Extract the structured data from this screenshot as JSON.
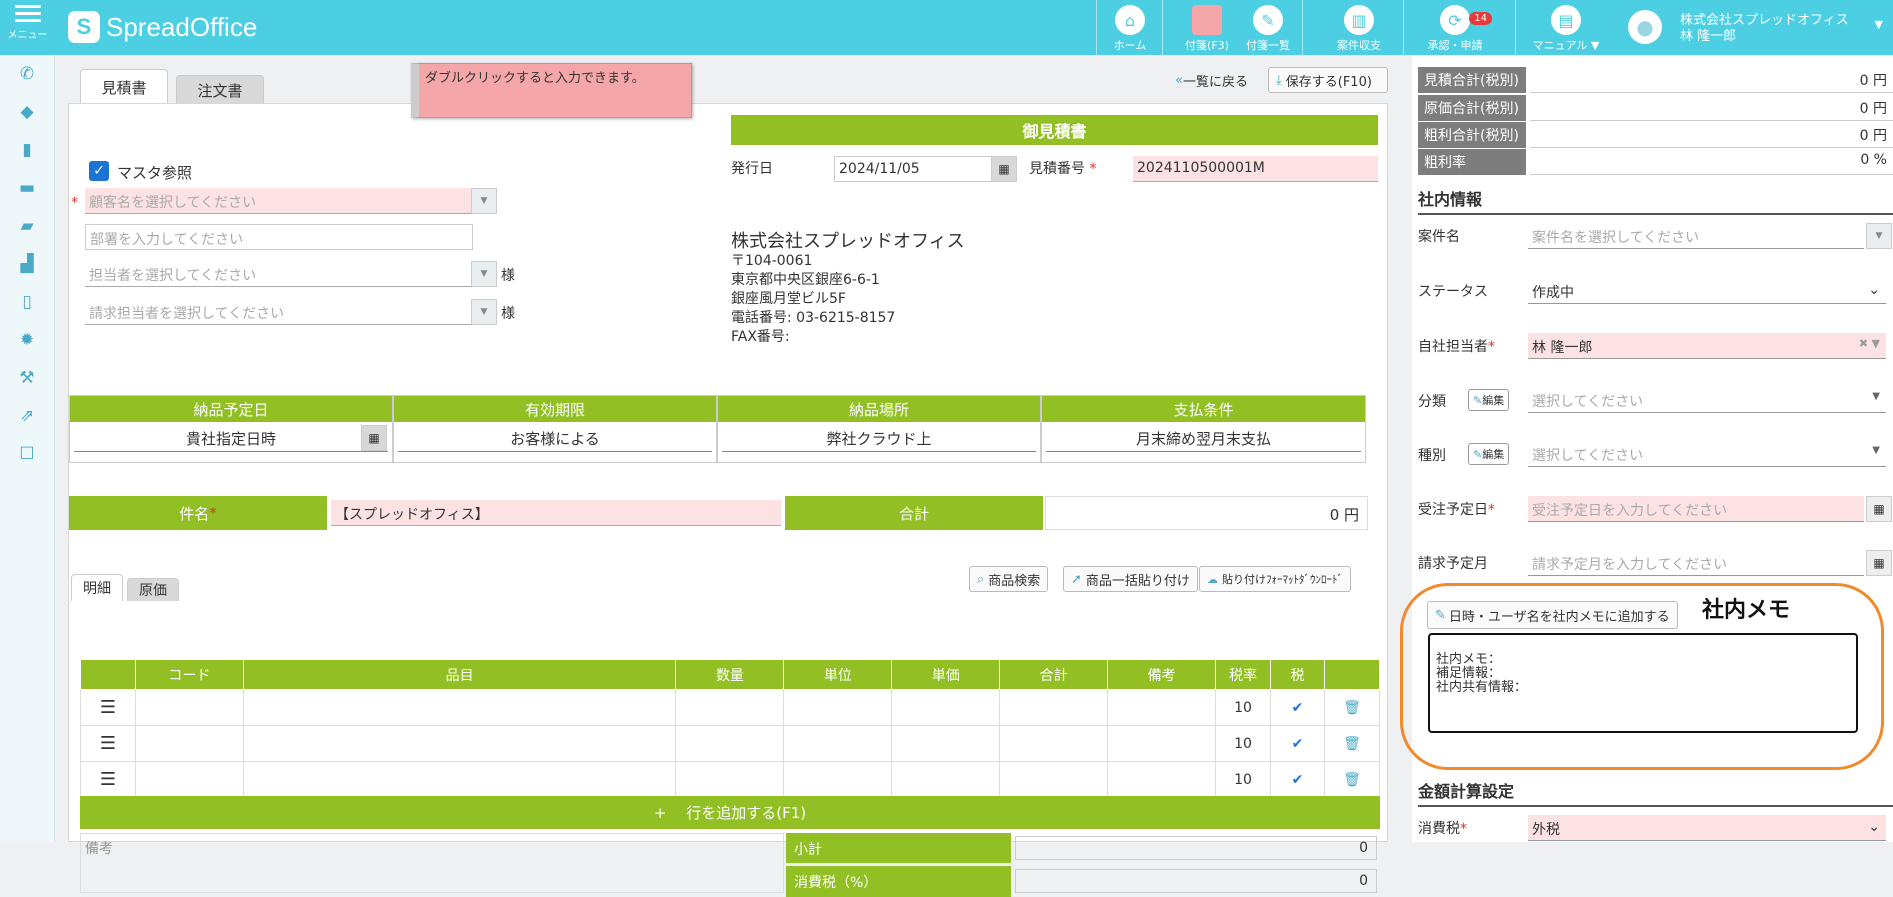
{
  "app": {
    "menu_label": "メニュー",
    "brand": "SpreadOffice"
  },
  "nav": {
    "home": "ホーム",
    "sticky_f3": "付箋(F3)",
    "sticky_list": "付箋一覧",
    "project": "案件収支",
    "approval": "承認・申請",
    "approval_count": "14",
    "manual": "マニュアル ▼"
  },
  "user": {
    "company": "株式会社スプレッドオフィス",
    "name": "林 隆一郎"
  },
  "tabs": {
    "estimate": "見積書",
    "order": "注文書"
  },
  "sticky_note": "ダブルクリックすると入力できます。",
  "toolbar": {
    "back": "一覧に戻る",
    "save": "保存する(F10)"
  },
  "doc": {
    "title": "御見積書",
    "issue_label": "発行日",
    "issue_date": "2024/11/05",
    "number_label": "見積番号",
    "number": "2024110500001M",
    "company": "株式会社スプレッドオフィス",
    "zip": "〒104-0061",
    "addr1": "東京都中央区銀座6-6-1",
    "addr2": "銀座風月堂ビル5F",
    "tel": "電話番号:  03-6215-8157",
    "fax": "FAX番号:"
  },
  "customer": {
    "master_ref": "マスタ参照",
    "customer_ph": "顧客名を選択してください",
    "dept_ph": "部署を入力してください",
    "person_ph": "担当者を選択してください",
    "billing_ph": "請求担当者を選択してください",
    "sama": "様"
  },
  "conditions": [
    {
      "h": "納品予定日",
      "v": "貴社指定日時"
    },
    {
      "h": "有効期限",
      "v": "お客様による"
    },
    {
      "h": "納品場所",
      "v": "弊社クラウド上"
    },
    {
      "h": "支払条件",
      "v": "月末締め翌月末支払"
    }
  ],
  "subject": {
    "label": "件名",
    "value": "【スプレッドオフィス】",
    "total_label": "合計",
    "total": "0 円"
  },
  "detail_tabs": {
    "detail": "明細",
    "cost": "原価"
  },
  "item_buttons": {
    "search": "商品検索",
    "paste": "商品一括貼り付け",
    "format": "貼り付けﾌｫｰﾏｯﾄﾀﾞｳﾝﾛｰﾄﾞ"
  },
  "table": {
    "headers": [
      "",
      "コード",
      "品目",
      "数量",
      "単位",
      "単価",
      "合計",
      "備考",
      "税率",
      "税",
      ""
    ],
    "rows": [
      {
        "rate": "10"
      },
      {
        "rate": "10"
      },
      {
        "rate": "10"
      }
    ],
    "add_row": "+ 　行を追加する(F1)"
  },
  "footer": {
    "remarks": "備考",
    "subtotal": "小計",
    "subtotal_val": "0",
    "tax": "消費税（%）",
    "tax_val": "0"
  },
  "summary": [
    {
      "k": "見積合計(税別)",
      "v": "0 円"
    },
    {
      "k": "原価合計(税別)",
      "v": "0 円"
    },
    {
      "k": "粗利合計(税別)",
      "v": "0 円"
    },
    {
      "k": "粗利率",
      "v": "0 %"
    }
  ],
  "internal": {
    "title": "社内情報",
    "project_label": "案件名",
    "project_ph": "案件名を選択してください",
    "status_label": "ステータス",
    "status": "作成中",
    "staff_label": "自社担当者",
    "staff": "林 隆一郎",
    "category_label": "分類",
    "type_label": "種別",
    "edit": "編集",
    "select_ph": "選択してください",
    "order_date_label": "受注予定日",
    "order_date_ph": "受注予定日を入力してください",
    "billing_month_label": "請求予定月",
    "billing_month_ph": "請求予定月を入力してください"
  },
  "memo": {
    "add_btn": "日時・ユーザ名を社内メモに追加する",
    "title": "社内メモ",
    "line1": "社内メモ：",
    "line2": "補足情報：",
    "line3": "社内共有情報："
  },
  "calc": {
    "title": "金額計算設定",
    "tax_label": "消費税",
    "tax_value": "外税"
  }
}
